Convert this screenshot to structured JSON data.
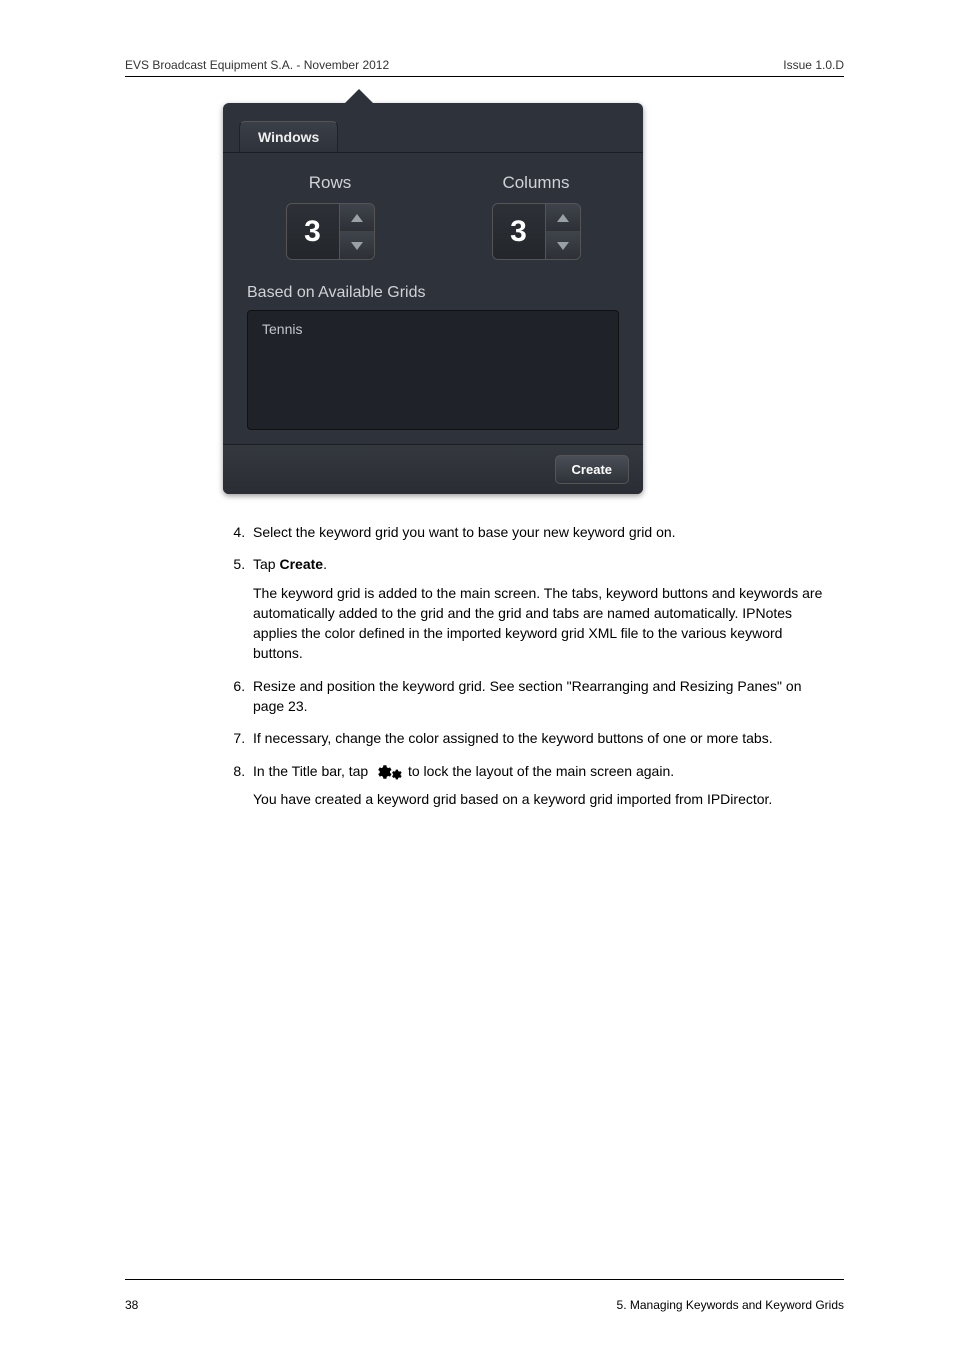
{
  "header": {
    "left": "EVS Broadcast Equipment S.A.  - November 2012",
    "right": "Issue 1.0.D"
  },
  "screenshot": {
    "tab_label": "Windows",
    "rows": {
      "label": "Rows",
      "value": "3"
    },
    "columns": {
      "label": "Columns",
      "value": "3"
    },
    "available_label": "Based on Available Grids",
    "grid_items": [
      "Tennis"
    ],
    "create_label": "Create"
  },
  "list": {
    "start": 4,
    "items": [
      {
        "text": "Select the keyword grid you want to base your new keyword grid on."
      },
      {
        "prefix": "Tap ",
        "bold": "Create",
        "suffix": ".",
        "para": "The keyword grid is added to the main screen. The tabs, keyword buttons and keywords are automatically added to the grid and the grid and tabs are named automatically. IPNotes applies the color defined in the imported keyword grid XML file to the various keyword buttons."
      },
      {
        "text": "Resize and position the keyword grid. See section \"Rearranging and Resizing Panes\" on page 23."
      },
      {
        "text": "If necessary, change the color assigned to the keyword buttons of one or more tabs."
      },
      {
        "prefix": "In the Title bar, tap ",
        "icon": true,
        "suffix": " to lock the layout of the main screen again.",
        "para": "You have created a keyword grid based on a keyword grid imported from IPDirector."
      }
    ]
  },
  "footer": {
    "page": "38",
    "section": "5. Managing Keywords and Keyword Grids"
  }
}
